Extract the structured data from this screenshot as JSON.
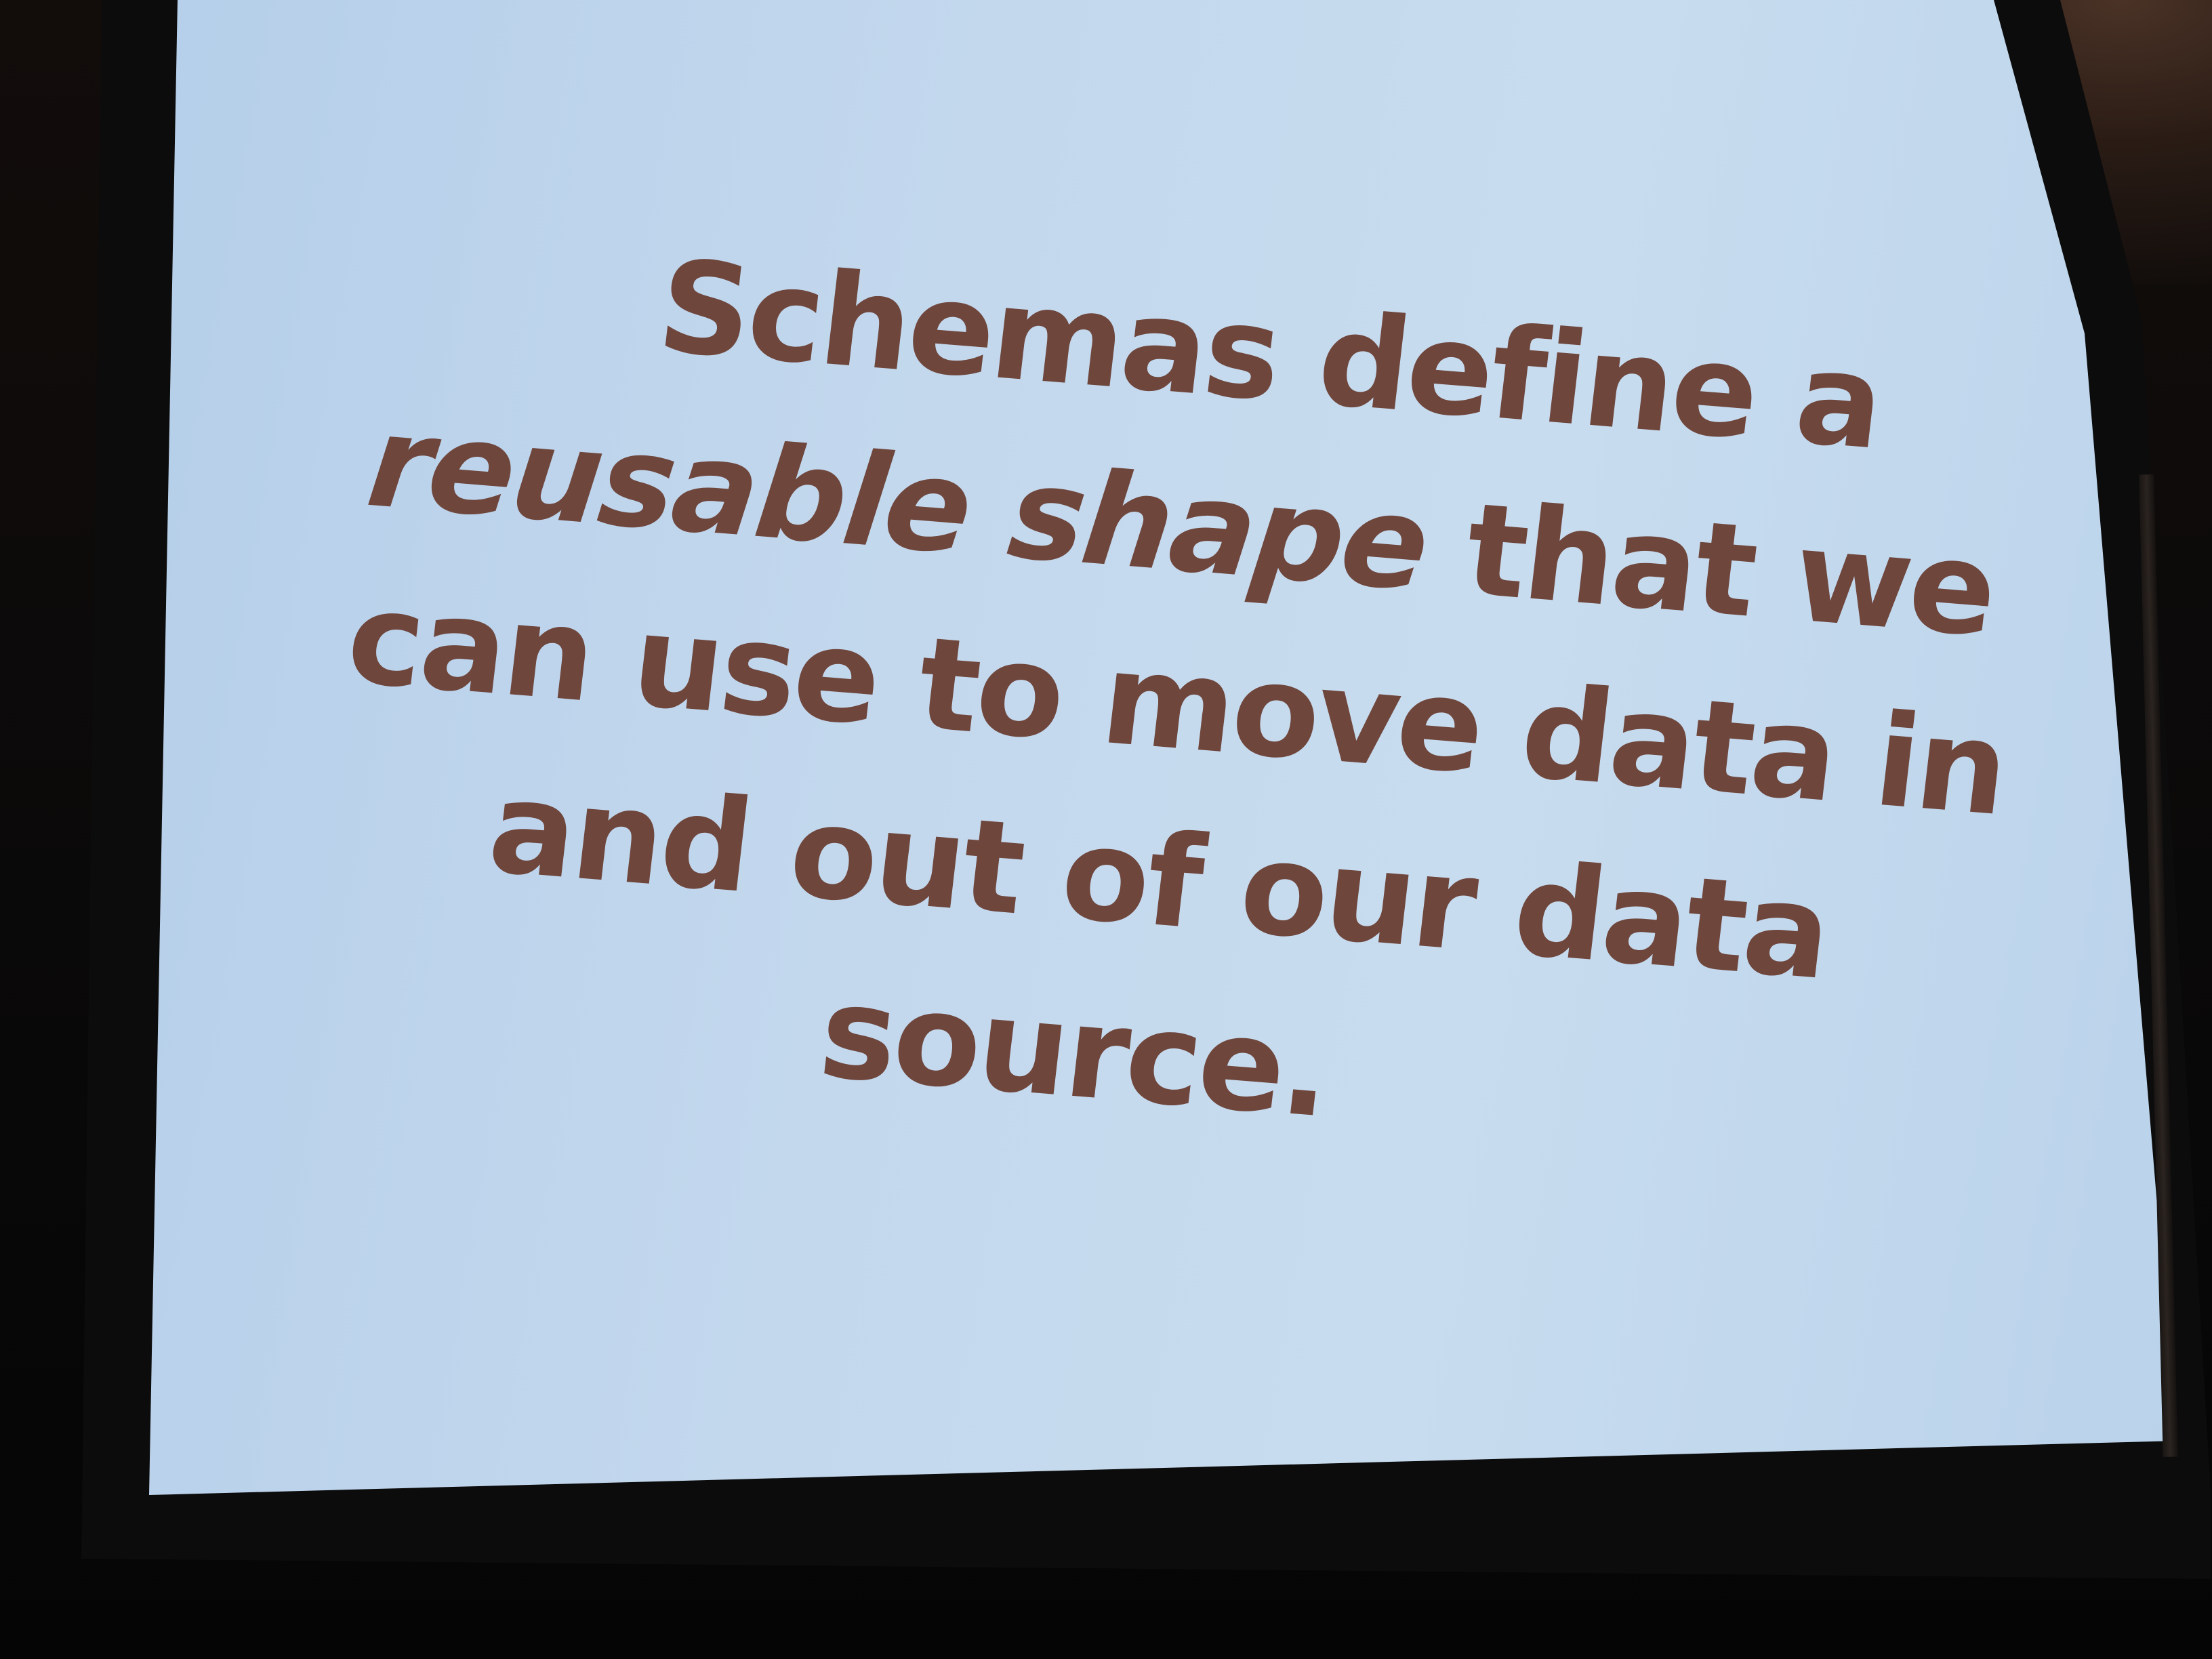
{
  "slide": {
    "lines": [
      "Schemas define a",
      "reusable shape that we",
      "can use to move data in",
      "and out of our data",
      "source."
    ],
    "line_2_italic": "reusable shape",
    "line_2_rest": " that we"
  },
  "colors": {
    "screen": "#c3d8ed",
    "text": "#6f463c",
    "room": "#0b0a0a"
  }
}
